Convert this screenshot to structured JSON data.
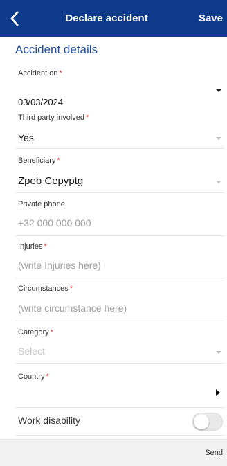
{
  "header": {
    "back_icon": "chevron-left-icon",
    "title": "Declare accident",
    "save_label": "Save",
    "background": "#0d3a8a"
  },
  "section": {
    "title": "Accident details"
  },
  "required_mark": "*",
  "fields": {
    "accident_on": {
      "label": "Accident on",
      "value": "03/03/2024"
    },
    "third_party": {
      "label": "Third party involved",
      "value": "Yes"
    },
    "beneficiary": {
      "label": "Beneficiary",
      "value": "Zpeb Cepyptg"
    },
    "private_phone": {
      "label": "Private phone",
      "placeholder": "+32 000 000 000"
    },
    "injuries": {
      "label": "Injuries",
      "placeholder": "(write Injuries here)"
    },
    "circumstances": {
      "label": "Circumstances",
      "placeholder": "(write circumstance here)"
    },
    "category": {
      "label": "Category",
      "placeholder": "Select"
    },
    "country": {
      "label": "Country",
      "value": ""
    },
    "work_disability": {
      "label": "Work disability",
      "enabled": false
    }
  },
  "footer": {
    "send_label": "Send"
  },
  "colors": {
    "accent": "#1f4e9a",
    "required": "#e53935"
  }
}
